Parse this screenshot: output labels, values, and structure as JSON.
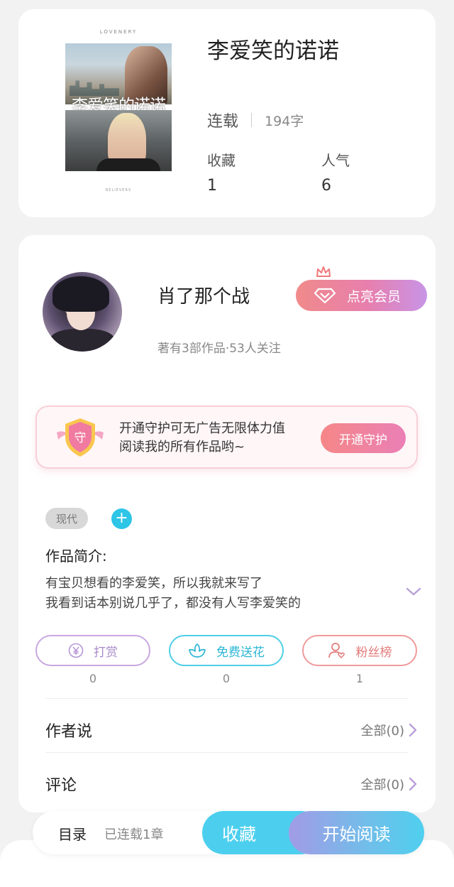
{
  "book": {
    "cover_top_label": "LOVENERY",
    "cover_title": "李爱笑的诺诺",
    "cover_bottom_label": "BELIEVERS",
    "title": "李爱笑的诺诺",
    "status": "连载",
    "word_count": "194字",
    "stats": [
      {
        "label": "收藏",
        "value": "1"
      },
      {
        "label": "人气",
        "value": "6"
      }
    ]
  },
  "author": {
    "name": "肖了那个战",
    "info": "著有3部作品·53人关注",
    "vip_label": "点亮会员"
  },
  "guard": {
    "badge_char": "守",
    "line1": "开通守护可无广告无限体力值",
    "line2": "阅读我的所有作品哟~",
    "button": "开通守护"
  },
  "tags": [
    "现代"
  ],
  "tag_add": "+",
  "intro": {
    "heading": "作品简介:",
    "line1": "有宝贝想看的李爱笑，所以我就来写了",
    "line2": "我看到话本别说几乎了，都没有人写李爱笑的"
  },
  "actions": [
    {
      "label": "打赏",
      "count": "0",
      "icon": "yuan-icon"
    },
    {
      "label": "免费送花",
      "count": "0",
      "icon": "flower-icon"
    },
    {
      "label": "粉丝榜",
      "count": "1",
      "icon": "fans-icon"
    }
  ],
  "sections": [
    {
      "title": "作者说",
      "more": "全部(0)"
    },
    {
      "title": "评论",
      "more": "全部(0)"
    }
  ],
  "bottom_bar": {
    "toc_label": "目录",
    "toc_status": "已连载1章",
    "favorite": "收藏",
    "read": "开始阅读"
  },
  "colors": {
    "accent_cyan": "#4ccfee",
    "vip_gradient_start": "#f08a8a",
    "vip_gradient_end": "#c894e7"
  }
}
